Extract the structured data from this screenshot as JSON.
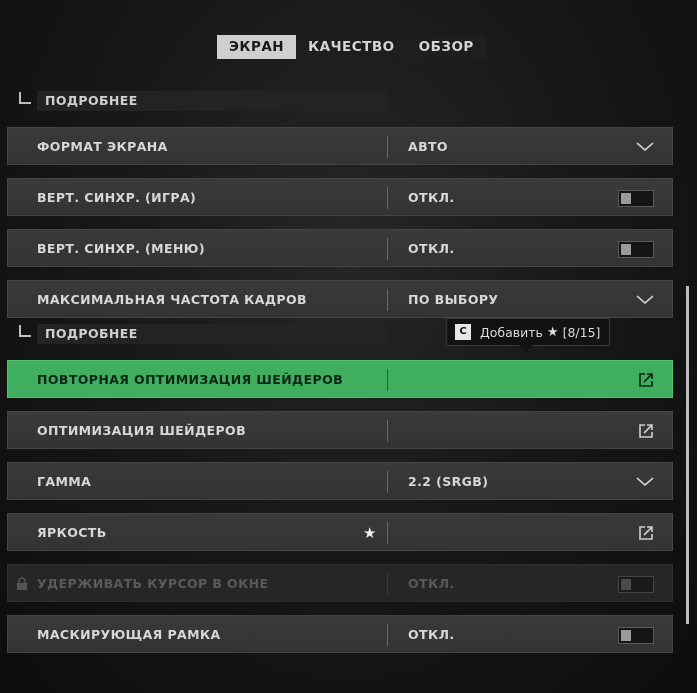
{
  "tabs": [
    {
      "label": "ЭКРАН"
    },
    {
      "label": "КАЧЕСТВО"
    },
    {
      "label": "ОБЗОР"
    }
  ],
  "details_label": "ПОДРОБНЕЕ",
  "rows": [
    {
      "label": "ФОРМАТ ЭКРАНА",
      "value": "АВТО",
      "control": "chevron-down-icon"
    },
    {
      "label": "ВЕРТ. СИНХР. (ИГРА)",
      "value": "ОТКЛ.",
      "control": "toggle"
    },
    {
      "label": "ВЕРТ. СИНХР. (МЕНЮ)",
      "value": "ОТКЛ.",
      "control": "toggle"
    },
    {
      "label": "МАКСИМАЛЬНАЯ ЧАСТОТА КАДРОВ",
      "value": "ПО ВЫБОРУ",
      "control": "chevron-down-icon"
    },
    {
      "label": "ПОВТОРНАЯ ОПТИМИЗАЦИЯ ШЕЙДЕРОВ",
      "value": "",
      "control": "external-link-icon"
    },
    {
      "label": "ОПТИМИЗАЦИЯ ШЕЙДЕРОВ",
      "value": "",
      "control": "external-link-icon"
    },
    {
      "label": "ГАММА",
      "value": "2.2 (SRGB)",
      "control": "chevron-down-icon"
    },
    {
      "label": "ЯРКОСТЬ",
      "value": "",
      "control": "external-link-icon",
      "favorite": true
    },
    {
      "label": "УДЕРЖИВАТЬ КУРСОР В ОКНЕ",
      "value": "ОТКЛ.",
      "control": "toggle",
      "disabled": true
    },
    {
      "label": "МАСКИРУЮЩАЯ РАМКА",
      "value": "ОТКЛ.",
      "control": "toggle"
    }
  ],
  "tooltip": {
    "key": "C",
    "text": "Добавить",
    "count": "[8/15]"
  },
  "colors": {
    "accent_green": "#3fae5f",
    "active_tab_bg": "#cfcfcf"
  }
}
